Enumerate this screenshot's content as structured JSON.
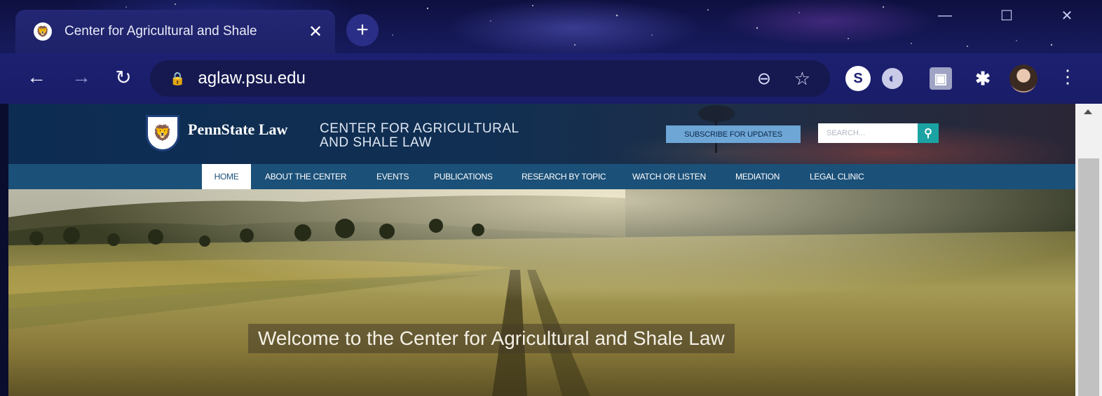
{
  "browser": {
    "tab_title": "Center for Agricultural and Shale",
    "tab_close": "✕",
    "new_tab": "+",
    "url": "aglaw.psu.edu",
    "window_minimize": "—",
    "window_maximize": "☐",
    "window_close": "✕",
    "extensions": [
      {
        "name": "s-extension-icon",
        "glyph": "S",
        "color": "#ffffff",
        "text_color": "#1c1f6e"
      },
      {
        "name": "circle-extension-icon",
        "glyph": "◐",
        "color": "#c9cbe8",
        "text_color": "#3a3f8c"
      },
      {
        "name": "screen-extension-icon",
        "glyph": "▣",
        "color": "#9fa3c4",
        "text_color": "#ffffff"
      }
    ]
  },
  "site": {
    "brand": "PennState Law",
    "center_name_line1": "CENTER FOR AGRICULTURAL",
    "center_name_line2": "AND SHALE LAW",
    "subscribe_label": "SUBSCRIBE FOR UPDATES",
    "search_placeholder": "SEARCH...",
    "nav": [
      "HOME",
      "ABOUT THE CENTER",
      "EVENTS",
      "PUBLICATIONS",
      "RESEARCH BY TOPIC",
      "WATCH OR LISTEN",
      "MEDIATION",
      "LEGAL CLINIC"
    ],
    "welcome": "Welcome to the Center for Agricultural and Shale Law"
  },
  "colors": {
    "nav_bar": "#1b5078",
    "subscribe_bg": "#6ea6d6",
    "search_button": "#1aa3a2",
    "psu_blue": "#1e407c"
  }
}
